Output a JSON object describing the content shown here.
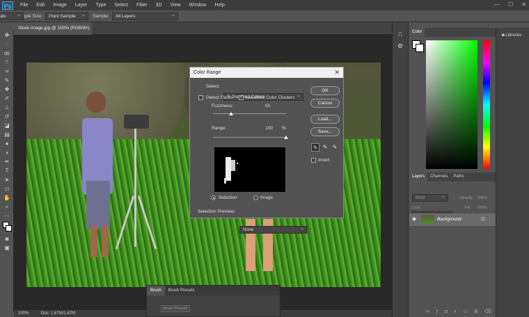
{
  "app": {
    "logo": "Ps",
    "menu": [
      "File",
      "Edit",
      "Image",
      "Layer",
      "Type",
      "Select",
      "Filter",
      "3D",
      "View",
      "Window",
      "Help"
    ]
  },
  "options": {
    "sample_size_label": "Sample Size:",
    "sample_size_value": "Point Sample",
    "sample_label": "Sample:",
    "sample_value": "All Layers",
    "workspace": "Essentials"
  },
  "document": {
    "tab_title": "Stock image.jpg @ 100% (RGB/8#)",
    "zoom": "100%",
    "doc_info": "Doc: 1.67M/1.67M"
  },
  "brush_panel": {
    "tabs": [
      "Brush",
      "Brush Presets"
    ],
    "button": "Brush Presets"
  },
  "dialog": {
    "title": "Color Range",
    "select_label": "Select:",
    "select_value": "Sampled Colors",
    "detect_faces": "Detect Faces",
    "localized": "Localized Color Clusters",
    "fuzziness_label": "Fuzziness:",
    "fuzziness_value": "50",
    "range_label": "Range:",
    "range_value": "100",
    "range_unit": "%",
    "radio_selection": "Selection",
    "radio_image": "Image",
    "preview_label": "Selection Preview:",
    "preview_value": "None",
    "ok": "OK",
    "cancel": "Cancel",
    "load": "Load...",
    "save": "Save...",
    "invert": "Invert",
    "fuzziness_fraction": 0.25,
    "range_fraction": 1.0
  },
  "color_panel": {
    "title": "Color",
    "accent_hue": "#00ff00"
  },
  "libraries": {
    "title": "Libraries"
  },
  "layers_panel": {
    "tabs": [
      "Layers",
      "Channels",
      "Paths"
    ],
    "kind": "Kind",
    "blend": "Normal",
    "opacity_label": "Opacity:",
    "opacity_value": "100%",
    "lock_label": "Lock:",
    "fill_label": "Fill:",
    "fill_value": "100%",
    "layer_name": "Background"
  }
}
